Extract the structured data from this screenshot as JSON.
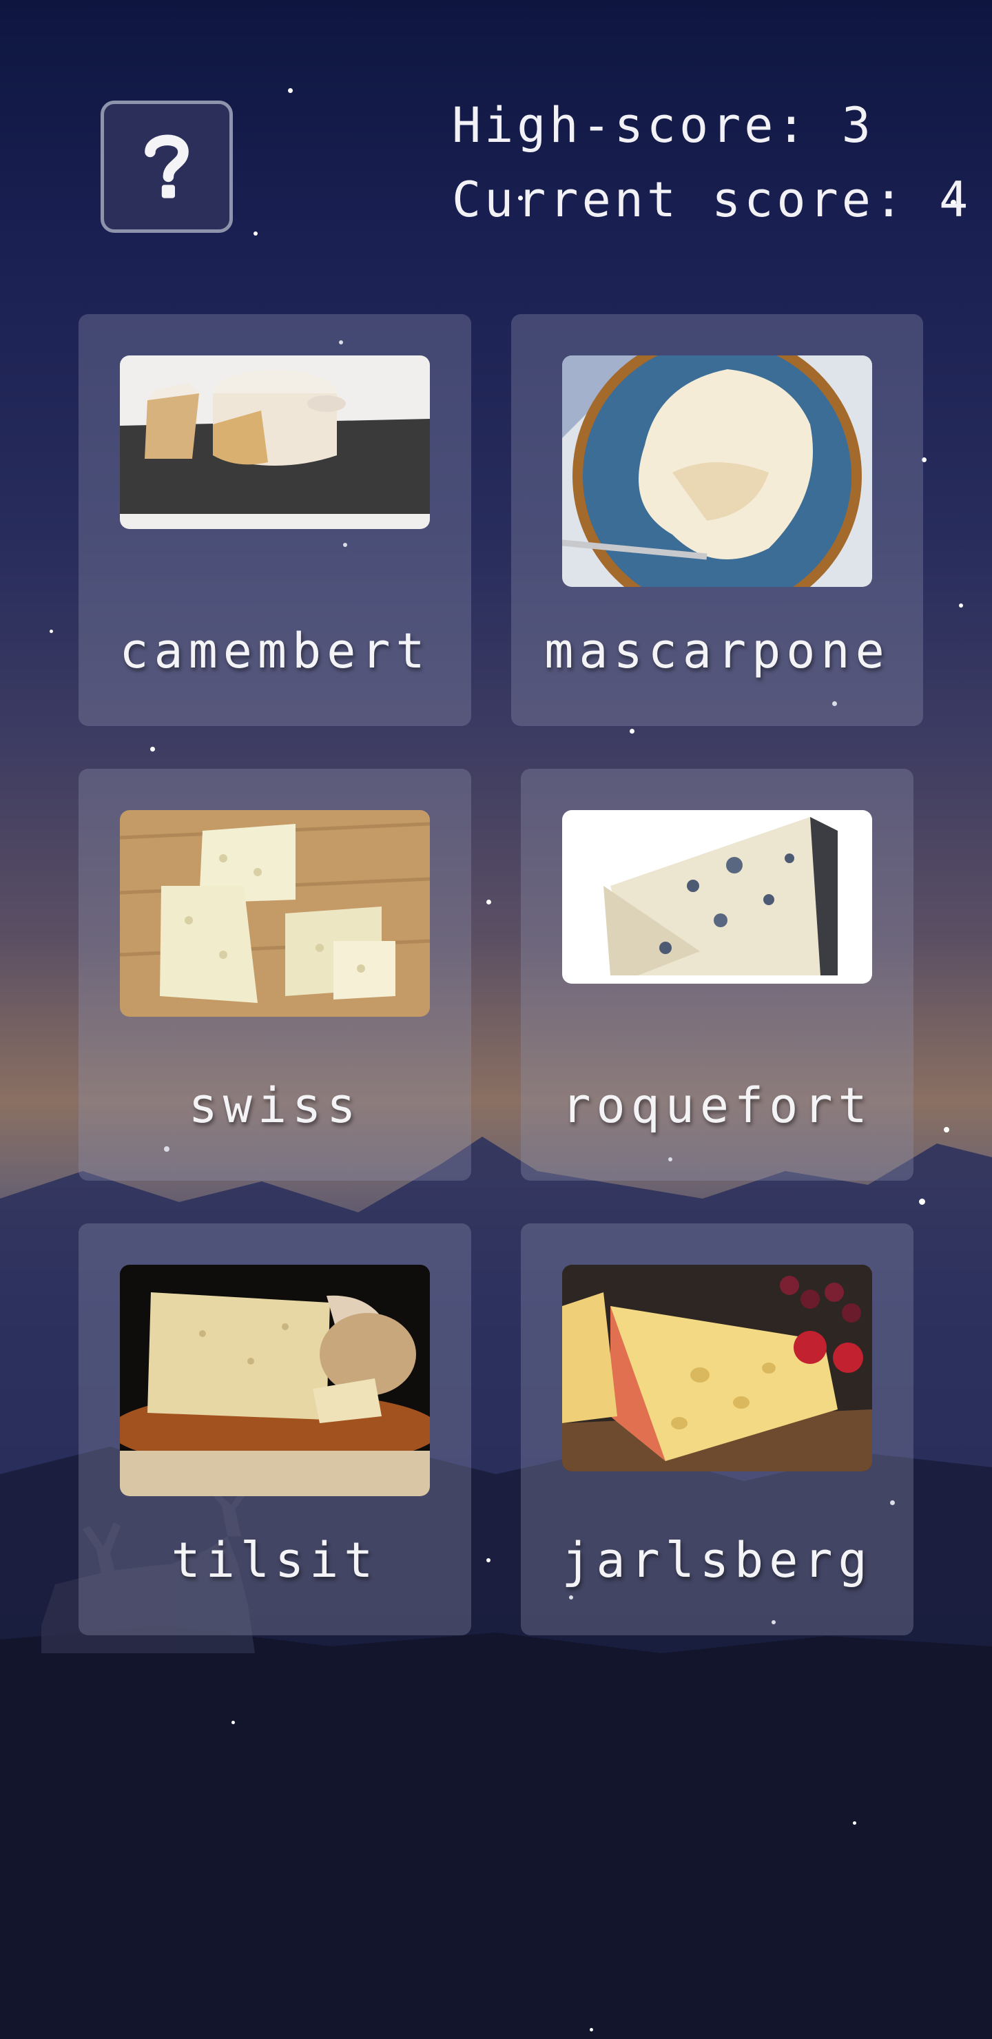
{
  "header": {
    "help_icon": "question-mark-icon",
    "high_score_label": "High-score: 3",
    "current_score_label": "Current score: 4"
  },
  "cards": [
    {
      "name": "camembert",
      "image": "camembert-photo"
    },
    {
      "name": "mascarpone",
      "image": "mascarpone-photo"
    },
    {
      "name": "swiss",
      "image": "swiss-photo"
    },
    {
      "name": "roquefort",
      "image": "roquefort-photo"
    },
    {
      "name": "tilsit",
      "image": "tilsit-photo"
    },
    {
      "name": "jarlsberg",
      "image": "jarlsberg-photo"
    }
  ],
  "colors": {
    "card_background": "#9194af",
    "text": "#f4f4f7",
    "sky_top": "#0e1640",
    "horizon": "#8a7062"
  }
}
